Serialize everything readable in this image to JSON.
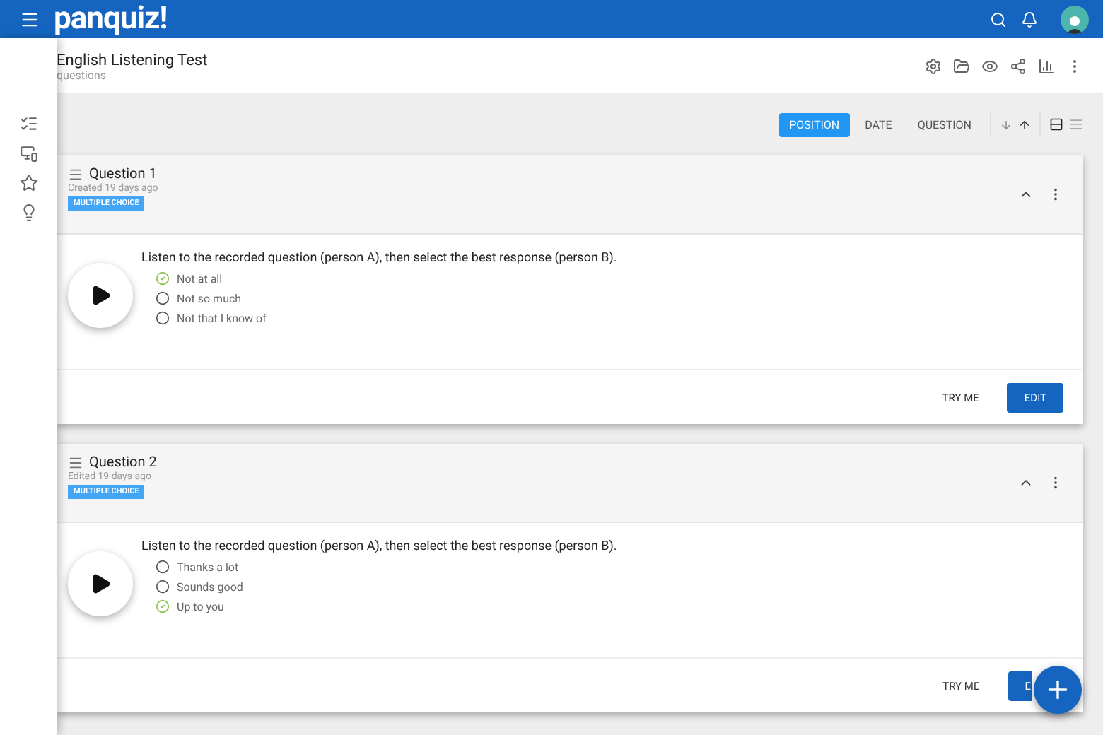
{
  "app_bar": {
    "logo": "panquiz!"
  },
  "quiz": {
    "title": "English Listening Test",
    "subtitle": "questions"
  },
  "sort": {
    "options": [
      {
        "label": "POSITION",
        "selected": true
      },
      {
        "label": "DATE",
        "selected": false
      },
      {
        "label": "QUESTION",
        "selected": false
      }
    ],
    "view": [
      {
        "kind": "cards",
        "selected": true
      },
      {
        "kind": "list",
        "selected": false
      }
    ]
  },
  "sidebar": {
    "items": [
      {
        "kind": "checklist"
      },
      {
        "kind": "devices"
      },
      {
        "kind": "star"
      },
      {
        "kind": "bulb"
      }
    ]
  },
  "questions": [
    {
      "title": "Question 1",
      "meta": "Created 19 days ago",
      "type": "MULTIPLE CHOICE",
      "prompt": "Listen to the recorded question (person A), then select the best response (person B).",
      "answers": [
        {
          "text": "Not at all",
          "correct": true
        },
        {
          "text": "Not so much",
          "correct": false
        },
        {
          "text": "Not that I know of",
          "correct": false
        }
      ],
      "try_label": "TRY ME",
      "edit_label": "EDIT"
    },
    {
      "title": "Question 2",
      "meta": "Edited 19 days ago",
      "type": "MULTIPLE CHOICE",
      "prompt": "Listen to the recorded question (person A), then select the best response (person B).",
      "answers": [
        {
          "text": "Thanks a lot",
          "correct": false
        },
        {
          "text": "Sounds good",
          "correct": false
        },
        {
          "text": "Up to you",
          "correct": true
        }
      ],
      "try_label": "TRY ME",
      "edit_label": "E"
    }
  ]
}
